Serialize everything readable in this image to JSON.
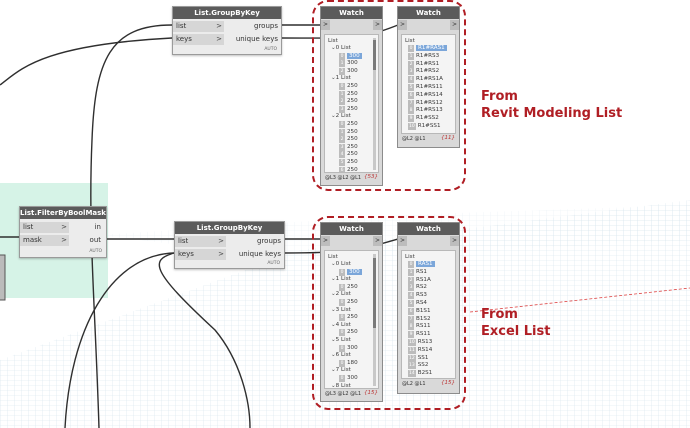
{
  "annotations": {
    "top": [
      "From",
      "Revit Modeling List"
    ],
    "bottom": [
      "From",
      "Excel List"
    ]
  },
  "colors": {
    "accent": "#b01e24",
    "node_title": "#5b5b5b",
    "selected": "#7ba6d9"
  },
  "filter_node": {
    "title": "List.FilterByBoolMask",
    "inputs": [
      "list",
      "mask"
    ],
    "outputs": [
      "in",
      "out"
    ],
    "lacing": "AUTO"
  },
  "groupby_top": {
    "title": "List.GroupByKey",
    "inputs": [
      "list",
      "keys"
    ],
    "outputs": [
      "groups",
      "unique keys"
    ],
    "lacing": "AUTO"
  },
  "groupby_bottom": {
    "title": "List.GroupByKey",
    "inputs": [
      "list",
      "keys"
    ],
    "outputs": [
      "groups",
      "unique keys"
    ],
    "lacing": "AUTO"
  },
  "watch_top_groups": {
    "title": "Watch",
    "root": "List",
    "lines": [
      "⌄0 List",
      "0 300",
      "1 300",
      "2 300",
      "⌄1 List",
      "0 250",
      "1 250",
      "2 250",
      "3 250",
      "⌄2 List",
      "0 250",
      "1 250",
      "2 250",
      "3 250",
      "4 250",
      "5 250",
      "6 250"
    ],
    "footer": "@L3 @L2 @L1",
    "count": "{53}"
  },
  "watch_top_keys": {
    "title": "Watch",
    "root": "List",
    "items": [
      "R1#RAS1",
      "R1#RS3",
      "R1#RS1",
      "R1#RS2",
      "R1#RS1A",
      "R1#RS11",
      "R1#RS14",
      "R1#RS12",
      "R1#RS13",
      "R1#SS2",
      "R1#SS1"
    ],
    "indices": [
      "0",
      "1",
      "2",
      "3",
      "4",
      "5",
      "6",
      "7",
      "8",
      "9",
      "10"
    ],
    "footer": "@L2 @L1",
    "count": "{11}"
  },
  "watch_bottom_groups": {
    "title": "Watch",
    "root": "List",
    "lines": [
      "⌄0 List",
      "0 300",
      "⌄1 List",
      "0 250",
      "⌄2 List",
      "0 250",
      "⌄3 List",
      "0 250",
      "⌄4 List",
      "0 250",
      "⌄5 List",
      "0 300",
      "⌄6 List",
      "0 180",
      "⌄7 List",
      "0 300",
      "⌄8 List"
    ],
    "footer": "@L3 @L2 @L1",
    "count": "{15}"
  },
  "watch_bottom_keys": {
    "title": "Watch",
    "root": "List",
    "items": [
      "RAS1",
      "RS1",
      "RS1A",
      "RS2",
      "RS3",
      "RS4",
      "B1S1",
      "B1S2",
      "RS11",
      "RS11",
      "RS13",
      "RS14",
      "SS1",
      "SS2",
      "B2S1"
    ],
    "indices": [
      "0",
      "1",
      "2",
      "3",
      "4",
      "5",
      "6",
      "7",
      "8",
      "9",
      "10",
      "11",
      "12",
      "13",
      "14"
    ],
    "footer": "@L2 @L1",
    "count": "{15}"
  }
}
